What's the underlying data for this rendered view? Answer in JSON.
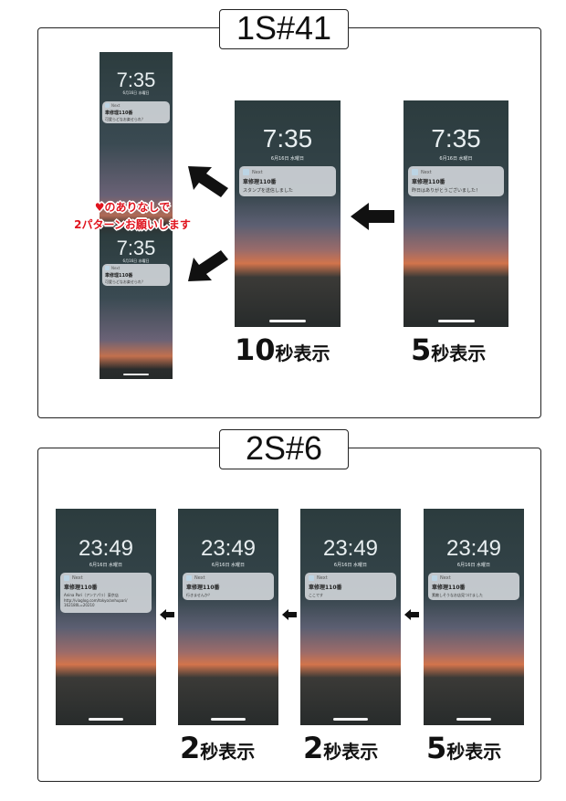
{
  "section1": {
    "badge": "1S#41",
    "note_line1": "♥のありなしで",
    "note_line2": "2パターンお願いします",
    "captions": [
      {
        "number": "10",
        "label": "秒表示"
      },
      {
        "number": "5",
        "label": "秒表示"
      }
    ],
    "phones": {
      "right": {
        "time": "7:35",
        "date": "6月16日 水曜日",
        "app": "Next",
        "title": "車修理110番",
        "message": "昨日はありがとうございました！"
      },
      "middle": {
        "time": "7:35",
        "date": "6月16日 水曜日",
        "app": "Next",
        "title": "車修理110番",
        "message": "スタンプを送信しました"
      },
      "left_top": {
        "time": "7:35",
        "date": "6月16日 水曜日",
        "app": "Next",
        "title": "車修理110番",
        "message": "可愛らどなお楽せられ？"
      },
      "left_bottom": {
        "time": "7:35",
        "date": "6月16日 水曜日",
        "app": "Next",
        "title": "車修理110番",
        "message": "可愛らどなお楽せられ？"
      }
    }
  },
  "section2": {
    "badge": "2S#6",
    "captions": [
      {
        "number": "2",
        "label": "秒表示"
      },
      {
        "number": "2",
        "label": "秒表示"
      },
      {
        "number": "5",
        "label": "秒表示"
      }
    ],
    "phones": [
      {
        "time": "23:49",
        "date": "6月16日 水曜日",
        "app": "Next",
        "title": "車修理110番",
        "message_lines": [
          "Anina Pari（アンナパリ）東京店",
          "http://viaglog.com/tokyo/anhupari/",
          "162180L=20210"
        ]
      },
      {
        "time": "23:49",
        "date": "6月16日 水曜日",
        "app": "Next",
        "title": "車修理110番",
        "message_lines": [
          "行きませんか？"
        ]
      },
      {
        "time": "23:49",
        "date": "6月16日 水曜日",
        "app": "Next",
        "title": "車修理110番",
        "message_lines": [
          "ここです"
        ]
      },
      {
        "time": "23:49",
        "date": "6月16日 水曜日",
        "app": "Next",
        "title": "車修理110番",
        "message_lines": [
          "素敵しそうなお店見つけました"
        ]
      }
    ]
  },
  "colors": {
    "note_red": "#e0141e",
    "sky_orange": "#d2744c",
    "wall_dark": "#2c3c3e"
  }
}
